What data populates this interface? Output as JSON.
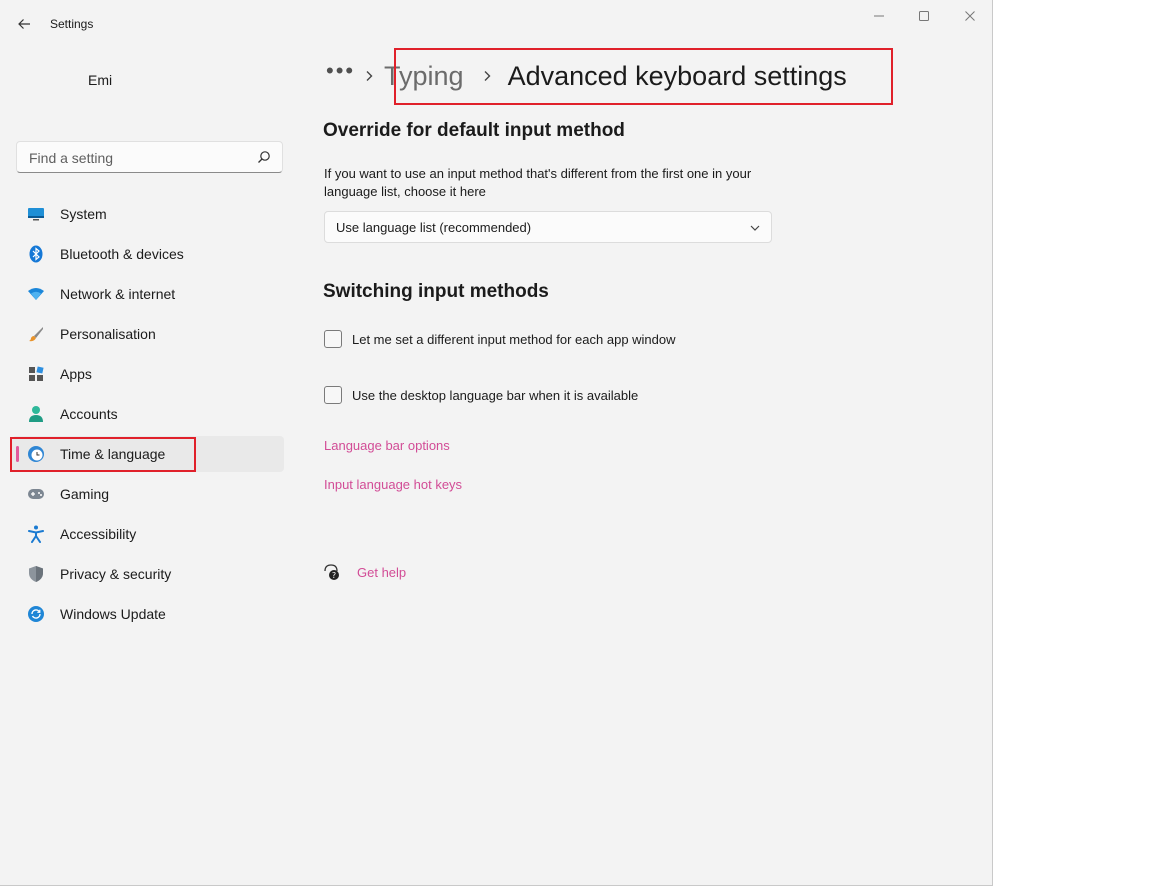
{
  "window": {
    "title": "Settings",
    "controls": [
      "minimize-icon",
      "maximize-icon",
      "close-icon"
    ]
  },
  "sidebar": {
    "user_name": "Emi",
    "search": {
      "placeholder": "Find a setting",
      "value": ""
    },
    "items": [
      {
        "label": "System",
        "icon": "system-icon",
        "selected": false
      },
      {
        "label": "Bluetooth & devices",
        "icon": "bluetooth-icon",
        "selected": false
      },
      {
        "label": "Network & internet",
        "icon": "wifi-icon",
        "selected": false
      },
      {
        "label": "Personalisation",
        "icon": "brush-icon",
        "selected": false
      },
      {
        "label": "Apps",
        "icon": "apps-icon",
        "selected": false
      },
      {
        "label": "Accounts",
        "icon": "account-icon",
        "selected": false
      },
      {
        "label": "Time & language",
        "icon": "globe-clock-icon",
        "selected": true
      },
      {
        "label": "Gaming",
        "icon": "gamepad-icon",
        "selected": false
      },
      {
        "label": "Accessibility",
        "icon": "accessibility-icon",
        "selected": false
      },
      {
        "label": "Privacy & security",
        "icon": "shield-icon",
        "selected": false
      },
      {
        "label": "Windows Update",
        "icon": "update-icon",
        "selected": false
      }
    ]
  },
  "breadcrumb": {
    "more": "•••",
    "parent": "Typing",
    "current": "Advanced keyboard settings"
  },
  "override": {
    "title": "Override for default input method",
    "description": "If you want to use an input method that's different from the first one in your language list, choose it here",
    "dropdown_value": "Use language list (recommended)"
  },
  "switching": {
    "title": "Switching input methods",
    "options": [
      {
        "label": "Let me set a different input method for each app window",
        "checked": false
      },
      {
        "label": "Use the desktop language bar when it is available",
        "checked": false
      }
    ]
  },
  "links": {
    "language_bar": "Language bar options",
    "hot_keys": "Input language hot keys",
    "help": "Get help"
  },
  "colors": {
    "accent": "#e25a9c",
    "link": "#d24c96",
    "highlight_box": "#e0202a"
  }
}
